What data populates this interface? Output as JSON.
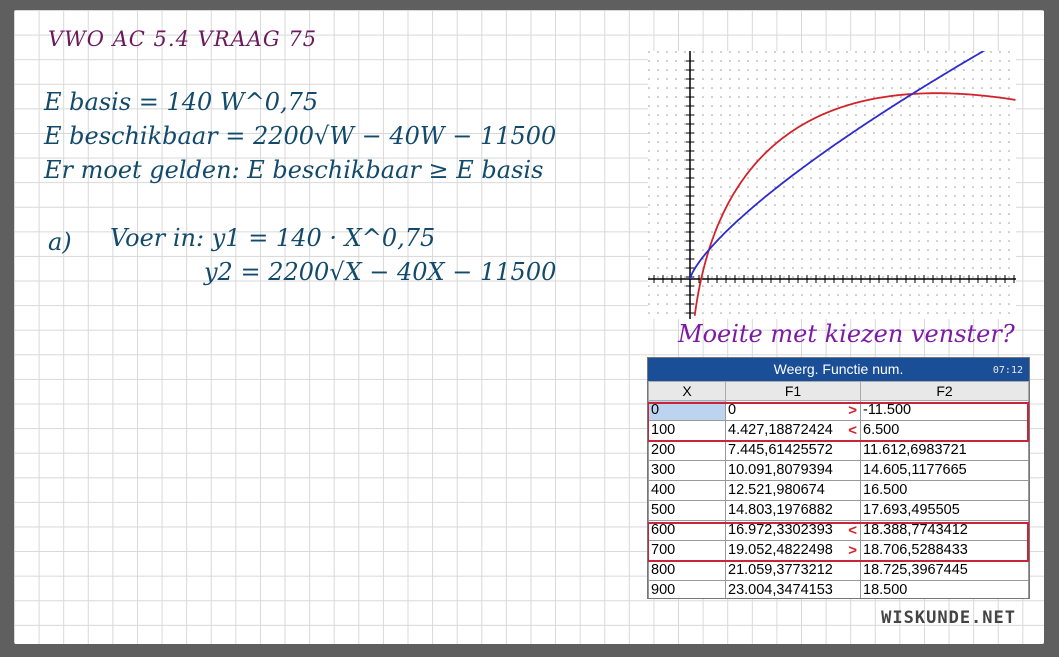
{
  "title": "VWO AC 5.4 VRAAG 75",
  "eq1": "E basis = 140 W^0,75",
  "eq2": "E beschikbaar = 2200√W − 40W − 11500",
  "eq3": "Er moet gelden: E beschikbaar ≥ E basis",
  "part_a": "a)",
  "voer_in": "Voer in:  y1 = 140 · X^0,75",
  "y2": "y2 = 2200√X − 40X − 11500",
  "graph_note": "Moeite met kiezen venster?",
  "calc": {
    "header": "Weerg. Functie num.",
    "clock": "07:12",
    "columns": [
      "X",
      "F1",
      "F2"
    ],
    "rows": [
      {
        "x": "0",
        "f1": "0",
        "arrow": ">",
        "f2": "-11.500"
      },
      {
        "x": "100",
        "f1": "4.427,18872424",
        "arrow": "<",
        "f2": "6.500"
      },
      {
        "x": "200",
        "f1": "7.445,61425572",
        "arrow": "",
        "f2": "11.612,6983721"
      },
      {
        "x": "300",
        "f1": "10.091,8079394",
        "arrow": "",
        "f2": "14.605,1177665"
      },
      {
        "x": "400",
        "f1": "12.521,980674",
        "arrow": "",
        "f2": "16.500"
      },
      {
        "x": "500",
        "f1": "14.803,1976882",
        "arrow": "",
        "f2": "17.693,495505"
      },
      {
        "x": "600",
        "f1": "16.972,3302393",
        "arrow": "<",
        "f2": "18.388,7743412"
      },
      {
        "x": "700",
        "f1": "19.052,4822498",
        "arrow": ">",
        "f2": "18.706,5288433"
      },
      {
        "x": "800",
        "f1": "21.059,3773212",
        "arrow": "",
        "f2": "18.725,3967445"
      },
      {
        "x": "900",
        "f1": "23.004,3474153",
        "arrow": "",
        "f2": "18.500"
      }
    ]
  },
  "brand": "WISKUNDE.NET",
  "colors": {
    "red_curve": "#d1232a",
    "blue_curve": "#2c2ccf",
    "header": "#1a4e96"
  }
}
